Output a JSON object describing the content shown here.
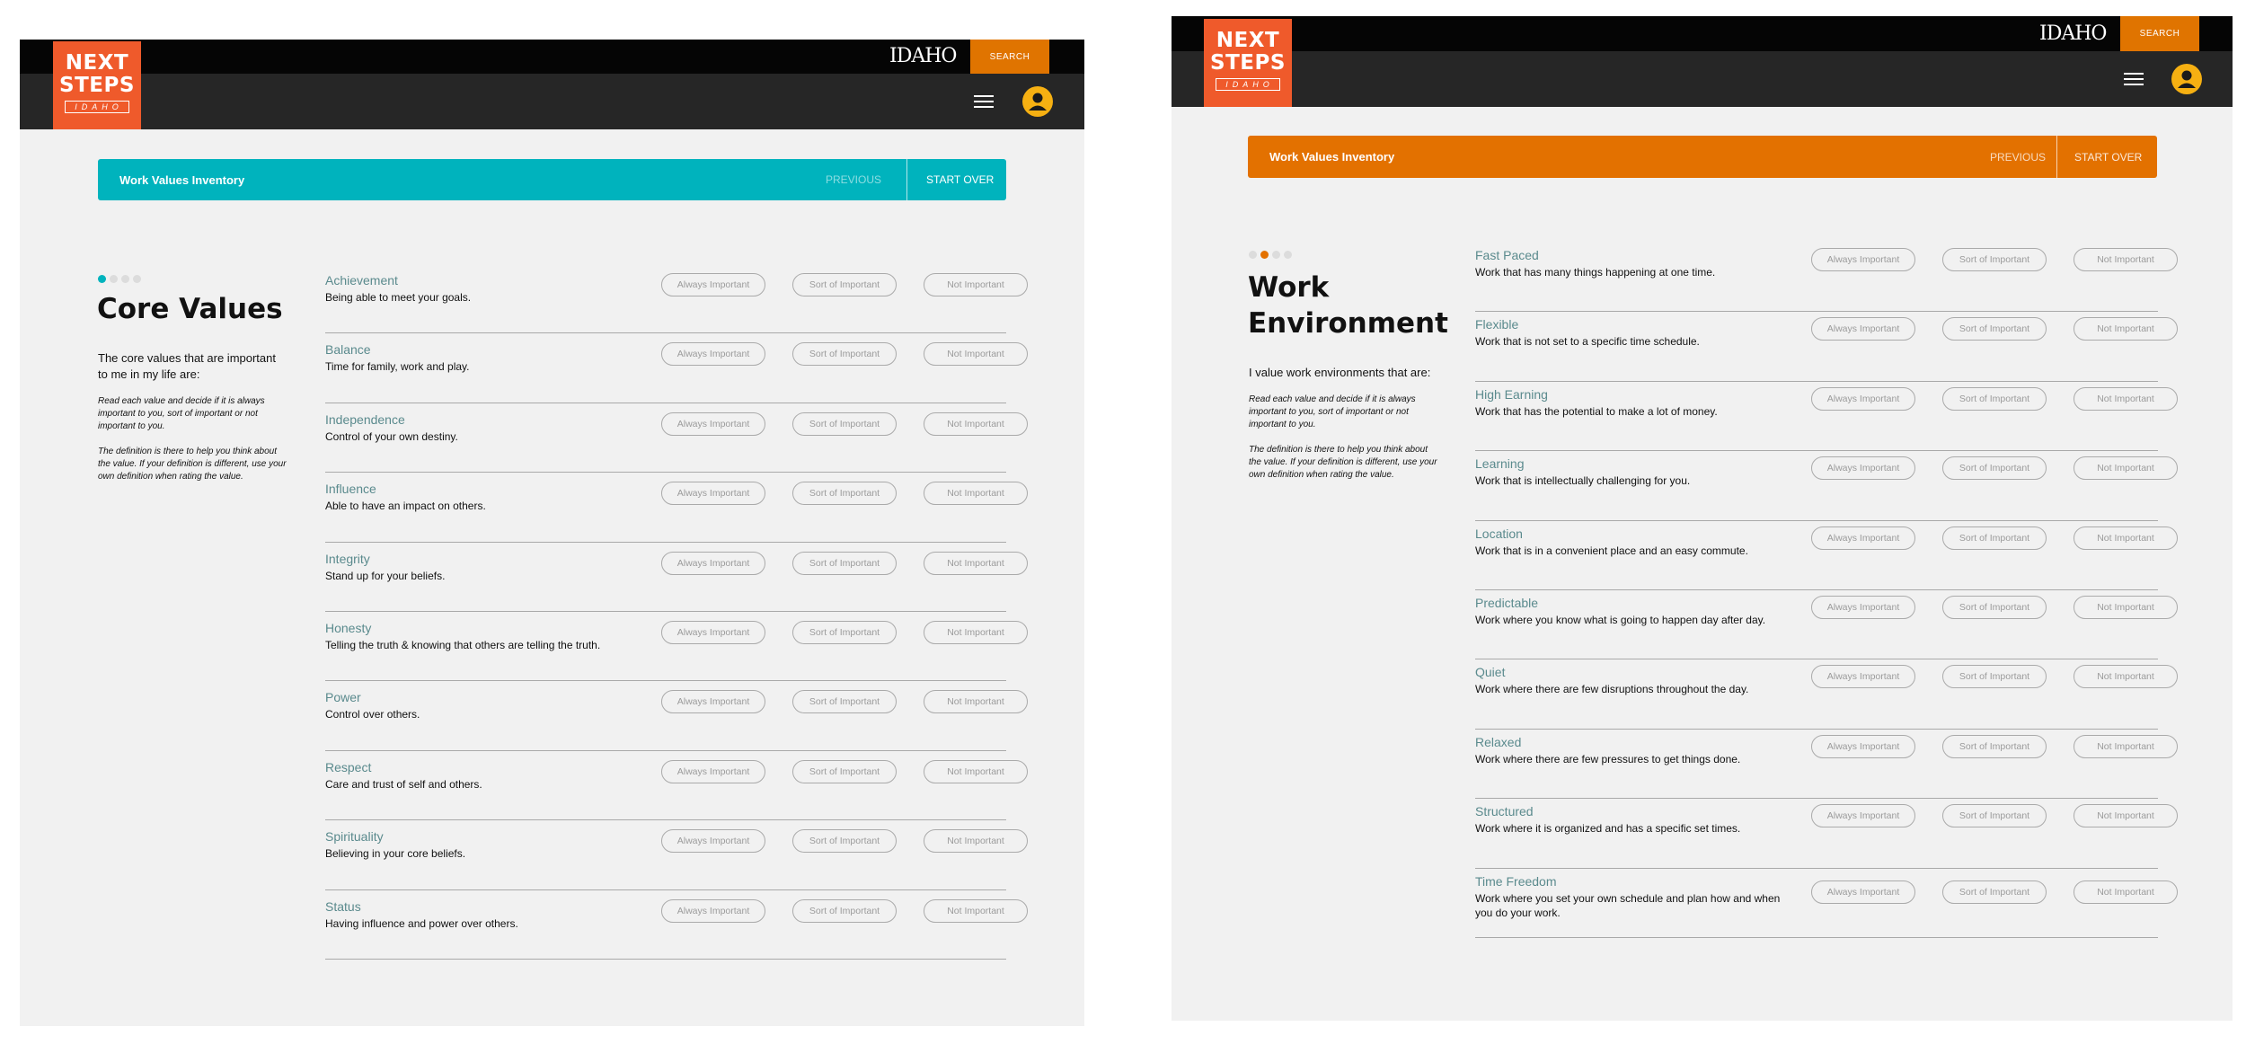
{
  "brand": {
    "logo_line1": "NEXT",
    "logo_line2": "STEPS",
    "logo_line3": "IDAHO",
    "idaho_mark": "IDAHO",
    "search_label": "SEARCH"
  },
  "colors": {
    "brand_orange": "#ef5a2b",
    "search_orange": "#e07400",
    "teal": "#00b3bd",
    "inventory_orange": "#e37100",
    "avatar_yellow": "#f6b012",
    "value_name": "#5a8a8d"
  },
  "icons": {
    "menu": "hamburger-menu-icon",
    "account": "user-avatar-icon"
  },
  "left": {
    "titlebar": {
      "title": "Work Values Inventory",
      "previous": "PREVIOUS",
      "start_over": "START OVER"
    },
    "step": {
      "total": 4,
      "current": 1
    },
    "section_title": "Core Values",
    "intro": "The core values that are important to me in my life are:",
    "note1": "Read each value and decide if it is always important to you, sort of important or not important to you.",
    "note2": "The definition is there to help you think about the value. If your definition is different, use your own definition when rating the value.",
    "options": [
      "Always Important",
      "Sort of Important",
      "Not Important"
    ],
    "items": [
      {
        "name": "Achievement",
        "desc": "Being able to meet your goals."
      },
      {
        "name": "Balance",
        "desc": "Time for family, work and play."
      },
      {
        "name": "Independence",
        "desc": "Control of your own destiny."
      },
      {
        "name": "Influence",
        "desc": "Able to have an impact on others."
      },
      {
        "name": "Integrity",
        "desc": "Stand up for your beliefs."
      },
      {
        "name": "Honesty",
        "desc": "Telling the truth & knowing that others are telling the truth."
      },
      {
        "name": "Power",
        "desc": "Control over others."
      },
      {
        "name": "Respect",
        "desc": "Care and trust of self and others."
      },
      {
        "name": "Spirituality",
        "desc": "Believing in your core beliefs."
      },
      {
        "name": "Status",
        "desc": "Having influence and power over others."
      }
    ]
  },
  "right": {
    "titlebar": {
      "title": "Work Values Inventory",
      "previous": "PREVIOUS",
      "start_over": "START OVER"
    },
    "step": {
      "total": 4,
      "current": 2
    },
    "section_title_line1": "Work",
    "section_title_line2": "Environment",
    "intro": "I value work environments that are:",
    "note1": "Read each value and decide if it is always important to you, sort of important or not important to you.",
    "note2": "The definition is there to help you think about the value. If your definition is different, use your own definition when rating the value.",
    "options": [
      "Always Important",
      "Sort of Important",
      "Not Important"
    ],
    "items": [
      {
        "name": "Fast Paced",
        "desc": "Work that has many things happening at one time."
      },
      {
        "name": "Flexible",
        "desc": "Work that is not set to a specific time schedule."
      },
      {
        "name": "High Earning",
        "desc": "Work that has the potential to make a lot of money."
      },
      {
        "name": "Learning",
        "desc": "Work that is intellectually challenging for you."
      },
      {
        "name": "Location",
        "desc": "Work that is in a convenient place and an easy commute."
      },
      {
        "name": "Predictable",
        "desc": "Work where you know what is going to happen day after day."
      },
      {
        "name": "Quiet",
        "desc": "Work where there are few disruptions throughout the day."
      },
      {
        "name": "Relaxed",
        "desc": "Work where there are few pressures to get things done."
      },
      {
        "name": "Structured",
        "desc": "Work where it is organized and has a specific set times."
      },
      {
        "name": "Time Freedom",
        "desc": "Work where you set your own schedule and plan how and when you do your work."
      }
    ]
  }
}
